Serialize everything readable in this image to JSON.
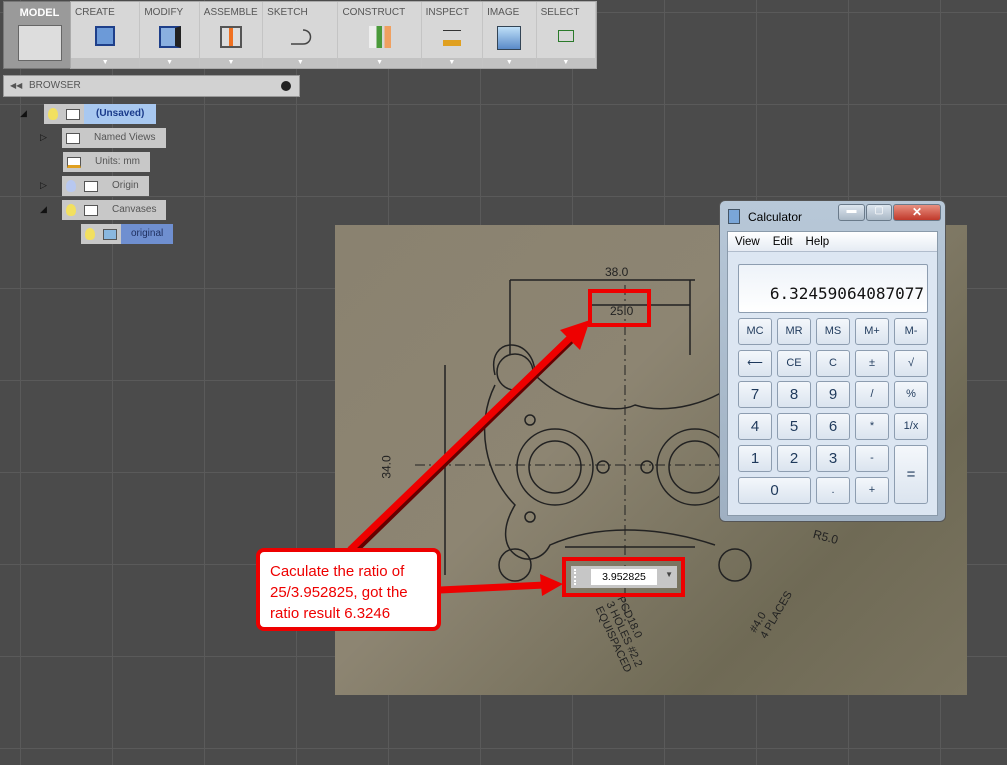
{
  "toolbar": {
    "model": "MODEL",
    "tools": [
      {
        "label": "CREATE",
        "icon": "box-icon"
      },
      {
        "label": "MODIFY",
        "icon": "press-pull-icon"
      },
      {
        "label": "ASSEMBLE",
        "icon": "joint-icon"
      },
      {
        "label": "SKETCH",
        "icon": "sketch-line-icon"
      },
      {
        "label": "CONSTRUCT",
        "icon": "plane-icon"
      },
      {
        "label": "INSPECT",
        "icon": "ruler-icon"
      },
      {
        "label": "IMAGE",
        "icon": "image-icon"
      },
      {
        "label": "SELECT",
        "icon": "select-box-icon"
      }
    ]
  },
  "browser": {
    "title": "BROWSER",
    "root": "(Unsaved)",
    "items": [
      "Named Views",
      "Units: mm",
      "Origin",
      "Canvases",
      "original"
    ]
  },
  "drawing": {
    "labels": [
      "38.0",
      "25.0",
      "34.0",
      "R5.0",
      "PCD18.0",
      "3 HOLES #2.2",
      "EQUISPACED",
      "#4.0",
      "4 PLACES"
    ]
  },
  "dimension_input": {
    "value": "3.952825"
  },
  "annotation": {
    "text": "Caculate the ratio of 25/3.952825, got the ratio result 6.3246",
    "color": "#e00000"
  },
  "calculator": {
    "title": "Calculator",
    "menu": [
      "View",
      "Edit",
      "Help"
    ],
    "display": "6.32459064087077",
    "keys": [
      "MC",
      "MR",
      "MS",
      "M+",
      "M-",
      "⟵",
      "CE",
      "C",
      "±",
      "√",
      "7",
      "8",
      "9",
      "/",
      "%",
      "4",
      "5",
      "6",
      "*",
      "1/x",
      "1",
      "2",
      "3",
      "-",
      "=",
      "0",
      ".",
      "+"
    ]
  }
}
